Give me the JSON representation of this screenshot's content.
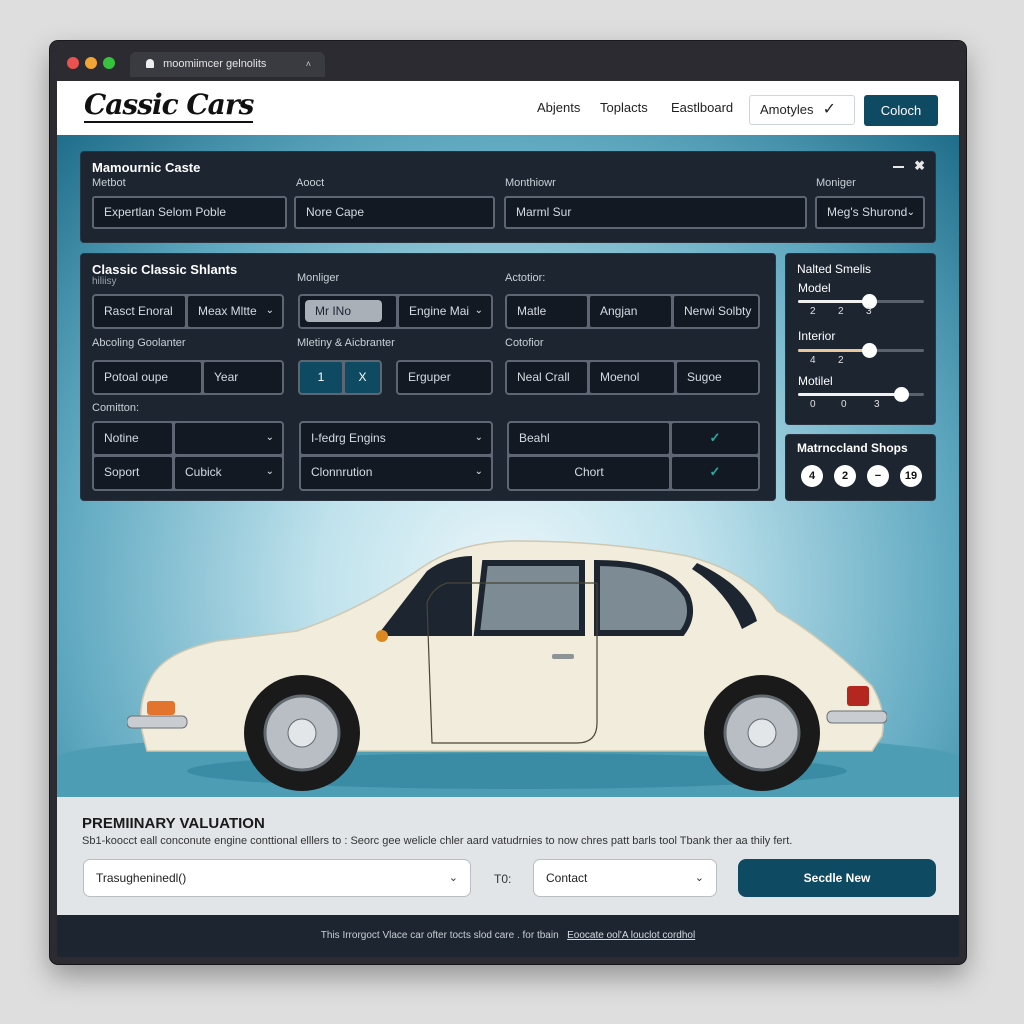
{
  "browser": {
    "tab_title": "moomiimcer gelnolits",
    "tab_close": "˄",
    "traffic_lights": [
      "#e9524f",
      "#f0a534",
      "#37c23e"
    ]
  },
  "navbar": {
    "logo": "Cassic Cars",
    "links": [
      "Abjents",
      "Toplacts",
      "Eastlboard"
    ],
    "dropdown": {
      "value": "Amotyles",
      "icon": "checkmark-icon"
    },
    "button": "Coloch",
    "accent": "#0f4a63"
  },
  "panel_top": {
    "title": "Mamournic Caste",
    "window_controls": {
      "minimize": "minimize-icon",
      "close": "✖"
    },
    "fields": [
      {
        "label": "Metbot",
        "value": "Expertlan Selom Poble"
      },
      {
        "label": "Aooct",
        "value": "Nore Cape"
      },
      {
        "label": "Monthiowr",
        "value": "Marml Sur"
      },
      {
        "label": "Moniger",
        "value": "Meg's Shurond",
        "dropdown": true
      }
    ]
  },
  "panel_main": {
    "title": "Classic Classic Shlants",
    "subtitle": "hiliisy",
    "sections": {
      "col1_row1": {
        "cells": [
          "Rasct Enoral",
          "Meax Mltte"
        ]
      },
      "col2_row1": {
        "label": "Monliger",
        "pill": "Mr INo",
        "cells": [
          "Engine Mai"
        ]
      },
      "col3_row1": {
        "label": "Actotior:",
        "cells": [
          "Matle",
          "Angjan",
          "Nerwi Solbty"
        ]
      },
      "col1_row2": {
        "label": "Abcoling Goolanter",
        "cells": [
          "Potoal oupe",
          "Year"
        ]
      },
      "col2_row2": {
        "label": "Mletiny & Aicbranter",
        "stepper": [
          "1",
          "X"
        ],
        "cells": [
          "Erguper"
        ]
      },
      "col3_row2": {
        "label": "Cotofior",
        "cells": [
          "Neal Crall",
          "Moenol",
          "Sugoe"
        ]
      },
      "col1_row3": {
        "label": "Comitton:",
        "rows": [
          [
            "Notine",
            ""
          ],
          [
            "Soport",
            "Cubick"
          ]
        ]
      },
      "col2_row3": {
        "rows": [
          "I-fedrg Engins",
          "Clonnrution"
        ]
      },
      "col3_row3": {
        "rows": [
          [
            "Beahl",
            "check"
          ],
          [
            "Chort",
            "check"
          ]
        ]
      }
    }
  },
  "sliders_panel": {
    "title": "Nalted Smelis",
    "sliders": [
      {
        "label": "Model",
        "value": 0.56,
        "ticks": [
          "2",
          "2",
          "3"
        ]
      },
      {
        "label": "Interior",
        "value": 0.56,
        "ticks": [
          "4",
          "2"
        ]
      },
      {
        "label": "Motilel",
        "value": 0.82,
        "ticks": [
          "0",
          "0",
          "3"
        ]
      }
    ]
  },
  "shops_panel": {
    "title": "Matrnccland Shops",
    "badges": [
      "4",
      "2",
      "−",
      "19"
    ]
  },
  "valuation": {
    "title": "PREMIINARY VALUATION",
    "description": "Sb1-koocct eall conconute engine conttional elllers to : Seorc gee welicle chler aard vatudrnies to now chres patt barls tool Tbank ther aa thily fert.",
    "select_primary": "Trasugheninedl()",
    "to_label": "T0:",
    "select_contact": "Contact",
    "button": "Secdle New"
  },
  "footer": {
    "text": "This Irrorgoct Vlace car ofter tocts slod care . for tbain",
    "link": "Eoocate ool'A louclot cordhol"
  }
}
